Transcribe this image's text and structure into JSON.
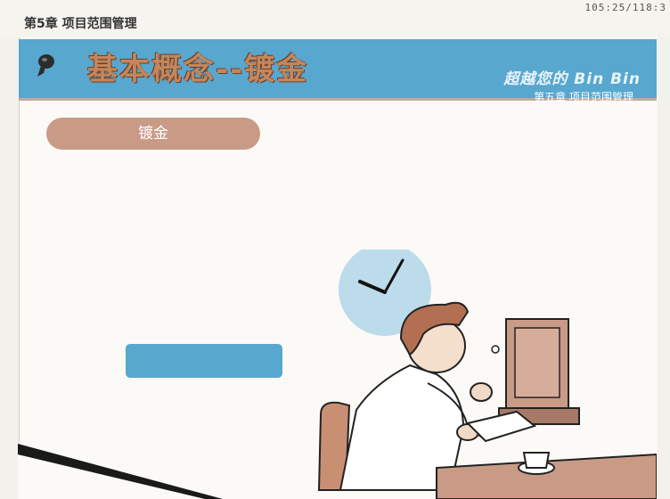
{
  "header": {
    "chapter_label": "第5章 项目范围管理",
    "timer": "105:25/118:3"
  },
  "banner": {
    "title": "基本概念--镀金",
    "brand": "超越您的 Bin Bin",
    "subtitle": "第五章 项目范围管理"
  },
  "content": {
    "pill_label": "镀金",
    "blue_box_label": ""
  },
  "colors": {
    "banner_blue": "#58a7cf",
    "pill": "#c99b87",
    "title_text": "#c4865c"
  }
}
